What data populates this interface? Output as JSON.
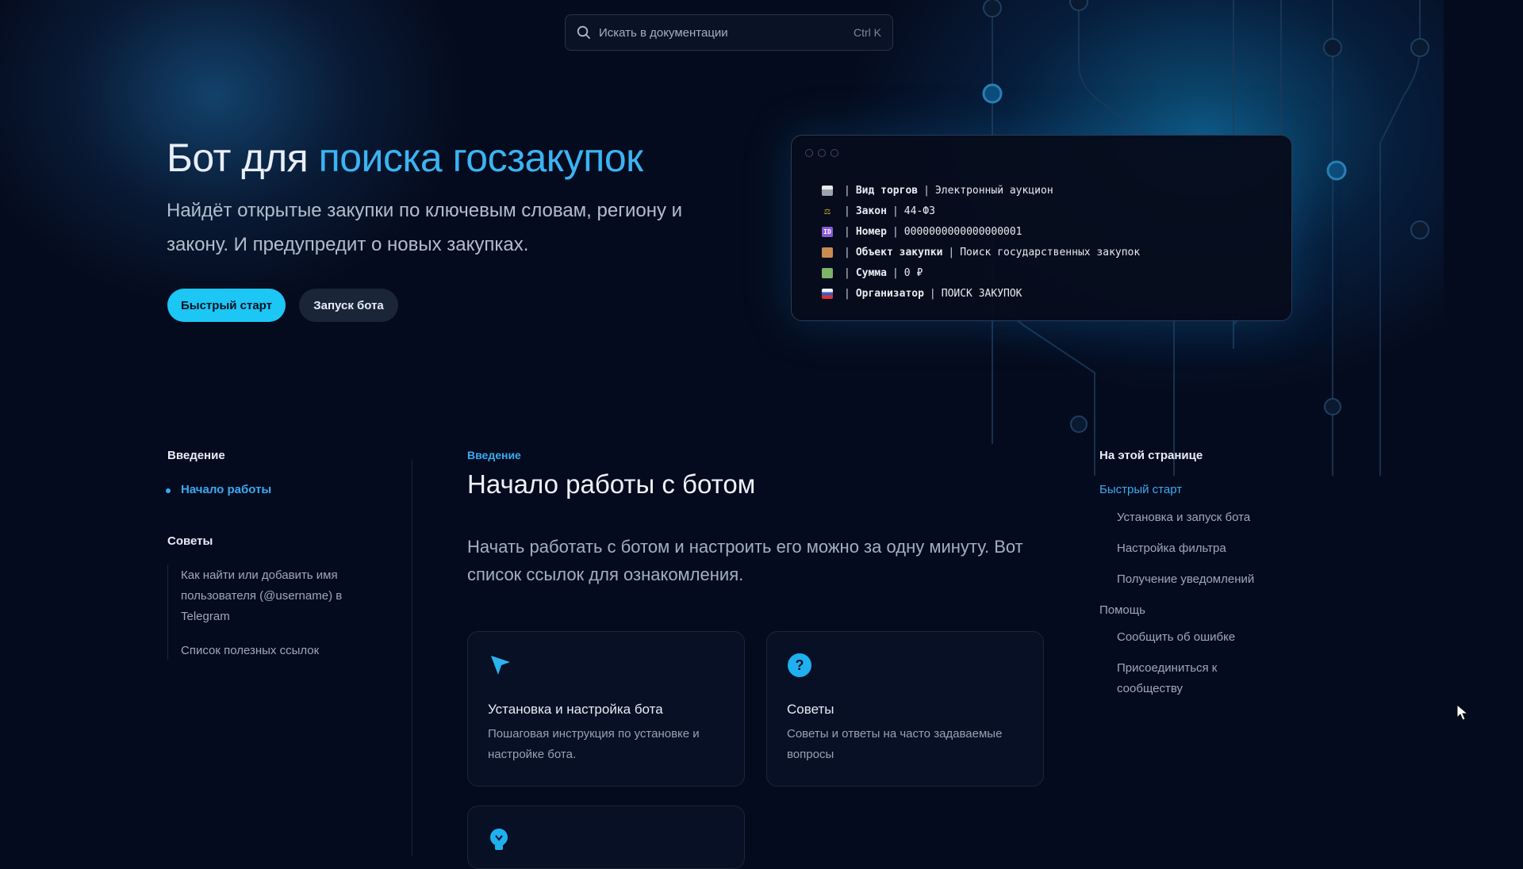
{
  "search": {
    "placeholder": "Искать в документации",
    "shortcut": "Ctrl K"
  },
  "hero": {
    "title_part1": "Бот для ",
    "title_accent": "поиска госзакупок",
    "subtitle": "Найдёт открытые закупки по ключевым словам, региону и закону. И предупредит о новых закупках.",
    "primary_button": "Быстрый старт",
    "secondary_button": "Запуск бота"
  },
  "terminal": {
    "lines": [
      {
        "icon": "printer-icon",
        "label": "Вид торгов",
        "value": "Электронный аукцион"
      },
      {
        "icon": "scales-icon",
        "label": "Закон",
        "value": "44-ФЗ"
      },
      {
        "icon": "id-icon",
        "label": "Номер",
        "value": "0000000000000000001"
      },
      {
        "icon": "package-icon",
        "label": "Объект закупки",
        "value": "Поиск государственных закупок"
      },
      {
        "icon": "money-icon",
        "label": "Сумма",
        "value": "0 ₽"
      },
      {
        "icon": "flag-icon",
        "label": "Организатор",
        "value": "ПОИСК ЗАКУПОК"
      }
    ]
  },
  "sidebar": {
    "section1_title": "Введение",
    "section1_items": [
      "Начало работы"
    ],
    "section2_title": "Советы",
    "section2_items": [
      "Как найти или добавить имя пользователя (@username) в Telegram",
      "Список полезных ссылок"
    ]
  },
  "main": {
    "breadcrumb": "Введение",
    "title": "Начало работы с ботом",
    "intro": "Начать работать с ботом и настроить его можно за одну минуту. Вот список ссылок для ознакомления.",
    "cards": [
      {
        "icon": "cursor-arrow-icon",
        "title": "Установка и настройка бота",
        "description": "Пошаговая инструкция по установке и настройке бота."
      },
      {
        "icon": "question-icon",
        "title": "Советы",
        "description": "Советы и ответы на часто задаваемые вопросы"
      },
      {
        "icon": "lightbulb-icon",
        "title": "",
        "description": ""
      }
    ]
  },
  "toc": {
    "title": "На этой странице",
    "items": [
      "Быстрый старт",
      "Установка и запуск бота",
      "Настройка фильтра",
      "Получение уведомлений",
      "Помощь",
      "Сообщить об ошибке",
      "Присоединиться к сообществу"
    ]
  },
  "colors": {
    "background": "#050b1e",
    "accent": "#3aaaf0",
    "primary_button": "#1cc6f5"
  }
}
